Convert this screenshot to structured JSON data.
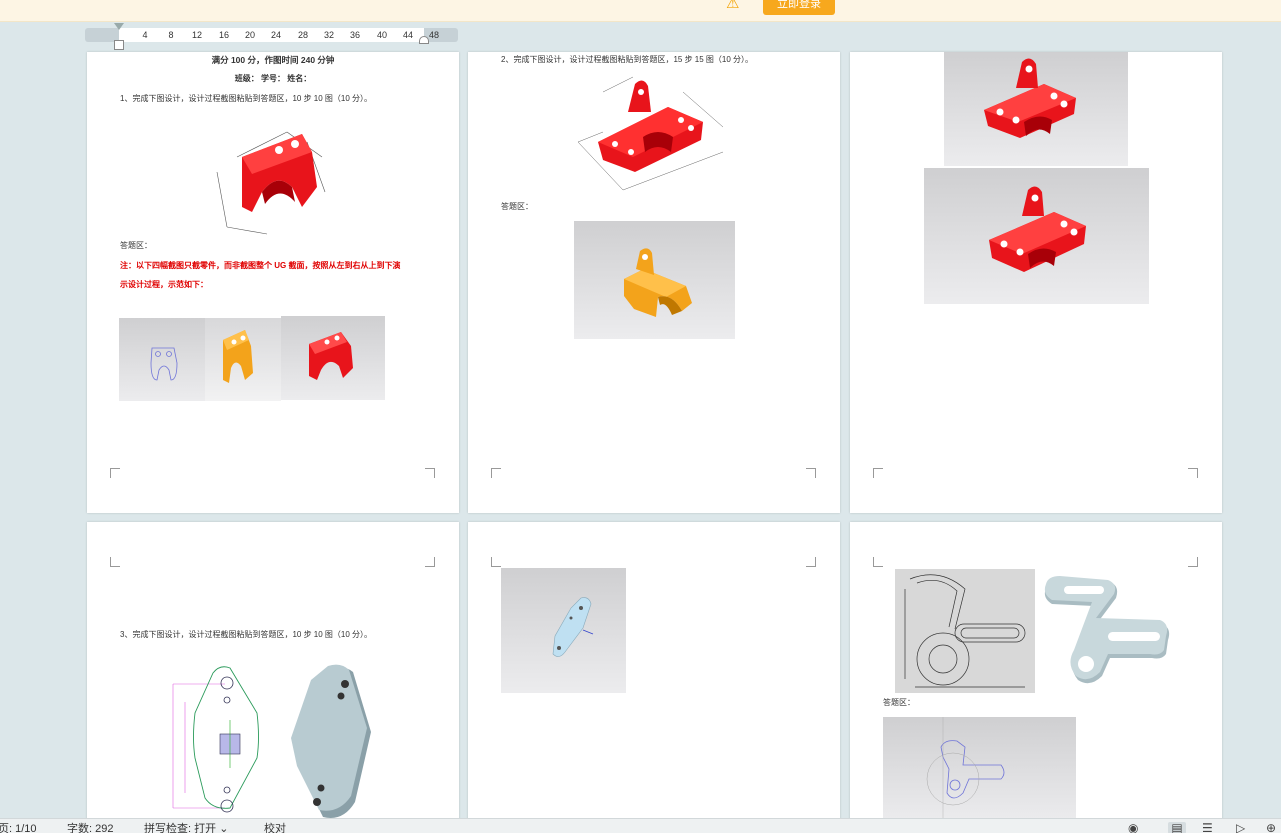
{
  "login_bar": {
    "button_label": "立即登录",
    "warning_icon": "warning-icon"
  },
  "ruler": {
    "ticks": [
      "4",
      "8",
      "12",
      "16",
      "20",
      "24",
      "28",
      "32",
      "36",
      "40",
      "44",
      "48"
    ]
  },
  "page1": {
    "title": "满分 100 分，作图时间 240 分钟",
    "meta": "班级：      学号：      姓名：",
    "q1": "1、完成下图设计，设计过程截图粘贴到答题区，10 步 10 图（10 分）。",
    "answer_area": "答题区：",
    "note_line1": "注：以下四幅截图只截零件，而非截图整个 UG 截面，按照从左到右从上到下演",
    "note_line2": "示设计过程，示范如下："
  },
  "page2": {
    "q2": "2、完成下图设计，设计过程截图粘贴到答题区，15 步 15 图（10 分）。",
    "answer_area": "答题区："
  },
  "page4": {
    "q3": "3、完成下图设计，设计过程截图粘贴到答题区，10 步 10 图（10 分）。"
  },
  "page6": {
    "answer_area": "答题区："
  },
  "status_bar": {
    "page": "页: 1/10",
    "words": "字数: 292",
    "spell": "拼写检查: 打开",
    "proof": "校对",
    "icons": [
      "eye-icon",
      "page-view-icon",
      "outline-view-icon",
      "play-icon",
      "globe-icon"
    ]
  },
  "colors": {
    "accent": "#f7a81d",
    "part_red": "#e8141b",
    "part_orange": "#f3a31b",
    "part_blue": "#bfe0f2",
    "part_gray": "#a9bcc2",
    "note_red": "#e00000"
  }
}
